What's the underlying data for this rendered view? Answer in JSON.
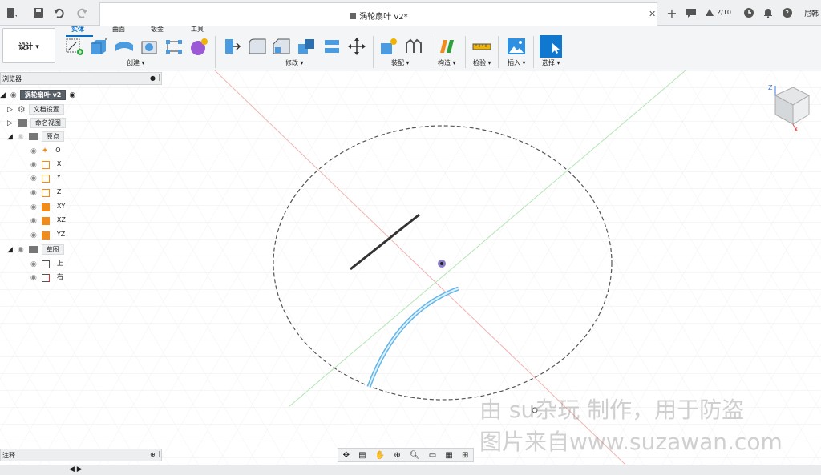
{
  "window": {
    "doc_title": "涡轮扇叶 v2*",
    "job_status": "2/10",
    "user": "尼韩"
  },
  "toolbar": {
    "workspace": "设计 ▾",
    "tabs": [
      "实体",
      "曲面",
      "钣金",
      "工具"
    ],
    "groups": [
      "创建 ▾",
      "修改 ▾",
      "装配 ▾",
      "构造 ▾",
      "检验 ▾",
      "插入 ▾",
      "选择 ▾"
    ]
  },
  "browser": {
    "title": "浏览器",
    "root": "涡轮扇叶 v2",
    "items": {
      "doc_settings": "文档设置",
      "named_views": "命名视图",
      "origin": "原点",
      "o": "O",
      "x": "X",
      "y": "Y",
      "z": "Z",
      "xy": "XY",
      "xz": "XZ",
      "yz": "YZ",
      "sketches": "草图",
      "top": "上",
      "right": "右"
    }
  },
  "comments": {
    "title": "注释"
  },
  "viewcube": {
    "axis_z": "Z",
    "axis_x": "X"
  },
  "watermark": {
    "line1": "由 su杂玩 制作，用于防盗",
    "line2": "图片来自www.suzawan.com"
  },
  "colors": {
    "accent": "#0a6cc2",
    "sketch_blue": "#64b6e8",
    "grid": "#e6e6e6"
  }
}
